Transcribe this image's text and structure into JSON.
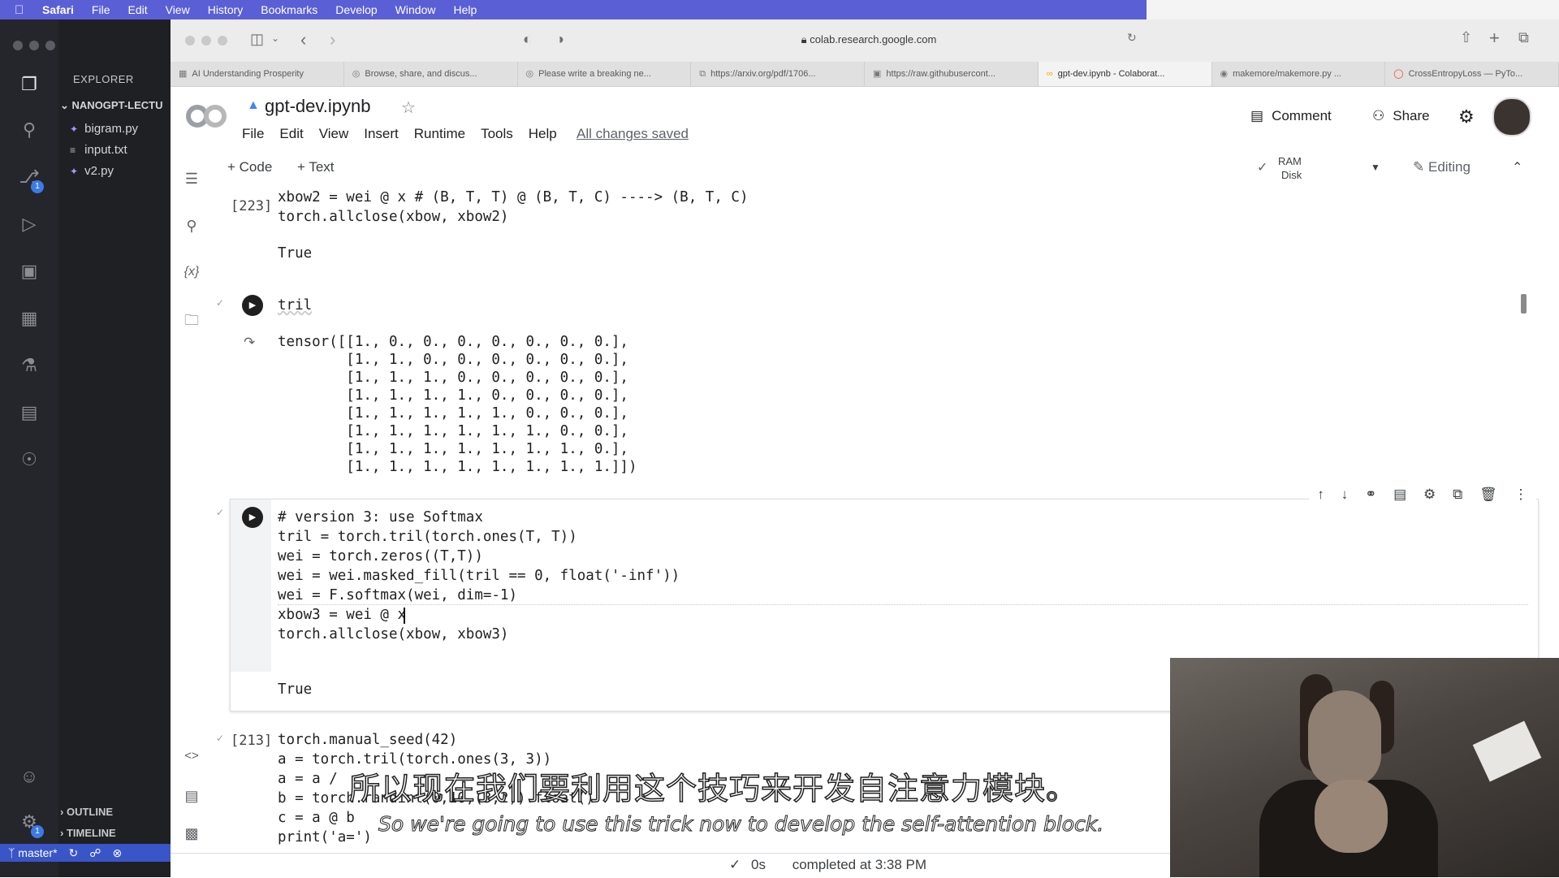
{
  "menubar": {
    "items": [
      "Safari",
      "File",
      "Edit",
      "View",
      "History",
      "Bookmarks",
      "Develop",
      "Window",
      "Help"
    ]
  },
  "vscode": {
    "explorer_title": "EXPLORER",
    "folder": "NANOGPT-LECTU",
    "files": [
      "bigram.py",
      "input.txt",
      "v2.py"
    ],
    "outline": "OUTLINE",
    "timeline": "TIMELINE",
    "branch": "master*",
    "source_control_badge": "1",
    "settings_badge": "1"
  },
  "browser": {
    "url": "colab.research.google.com",
    "tabs": [
      {
        "label": "AI Understanding Prosperity",
        "icon": "doc-icon"
      },
      {
        "label": "Browse, share, and discus...",
        "icon": "globe-icon"
      },
      {
        "label": "Please write a breaking ne...",
        "icon": "globe-icon"
      },
      {
        "label": "https://arxiv.org/pdf/1706...",
        "icon": "pdf-icon"
      },
      {
        "label": "https://raw.githubusercont...",
        "icon": "file-icon"
      },
      {
        "label": "gpt-dev.ipynb - Colaborat...",
        "icon": "colab-icon"
      },
      {
        "label": "makemore/makemore.py ...",
        "icon": "github-icon"
      },
      {
        "label": "CrossEntropyLoss — PyTo...",
        "icon": "pytorch-icon"
      }
    ],
    "active_tab": 5
  },
  "colab": {
    "notebook_title": "gpt-dev.ipynb",
    "menu": [
      "File",
      "Edit",
      "View",
      "Insert",
      "Runtime",
      "Tools",
      "Help"
    ],
    "save_status": "All changes saved",
    "comment_label": "Comment",
    "share_label": "Share",
    "add_code": "+ Code",
    "add_text": "+ Text",
    "ram_label": "RAM",
    "disk_label": "Disk",
    "editing_label": "Editing"
  },
  "cells": {
    "c1": {
      "exec": "[223]",
      "lines": [
        "xbow2 = wei @ x # (B, T, T) @ (B, T, C) ----> (B, T, C)",
        "torch.allclose(xbow, xbow2)"
      ],
      "output": "True"
    },
    "c2": {
      "code": "tril",
      "output": [
        "tensor([[1., 0., 0., 0., 0., 0., 0., 0.],",
        "        [1., 1., 0., 0., 0., 0., 0., 0.],",
        "        [1., 1., 1., 0., 0., 0., 0., 0.],",
        "        [1., 1., 1., 1., 0., 0., 0., 0.],",
        "        [1., 1., 1., 1., 1., 0., 0., 0.],",
        "        [1., 1., 1., 1., 1., 1., 0., 0.],",
        "        [1., 1., 1., 1., 1., 1., 1., 0.],",
        "        [1., 1., 1., 1., 1., 1., 1., 1.]])"
      ]
    },
    "c3": {
      "lines": [
        "# version 3: use Softmax",
        "tril = torch.tril(torch.ones(T, T))",
        "wei = torch.zeros((T,T))",
        "wei = wei.masked_fill(tril == 0, float('-inf'))",
        "wei = F.softmax(wei, dim=-1)",
        "xbow3 = wei @ x",
        "torch.allclose(xbow, xbow3)"
      ],
      "output": "True"
    },
    "c4": {
      "exec": "[213]",
      "lines": [
        "torch.manual_seed(42)",
        "a = torch.tril(torch.ones(3, 3))",
        "a = a / ",
        "b = torch.randint(0,10,(3,2)).float()",
        "c = a @ b",
        "print('a=')"
      ]
    }
  },
  "footer": {
    "duration": "0s",
    "completed": "completed at 3:38 PM"
  },
  "subtitles": {
    "cn": "所以现在我们要利用这个技巧来开发自注意力模块。",
    "en": "So we're going to use this trick now to develop the self-attention block."
  }
}
